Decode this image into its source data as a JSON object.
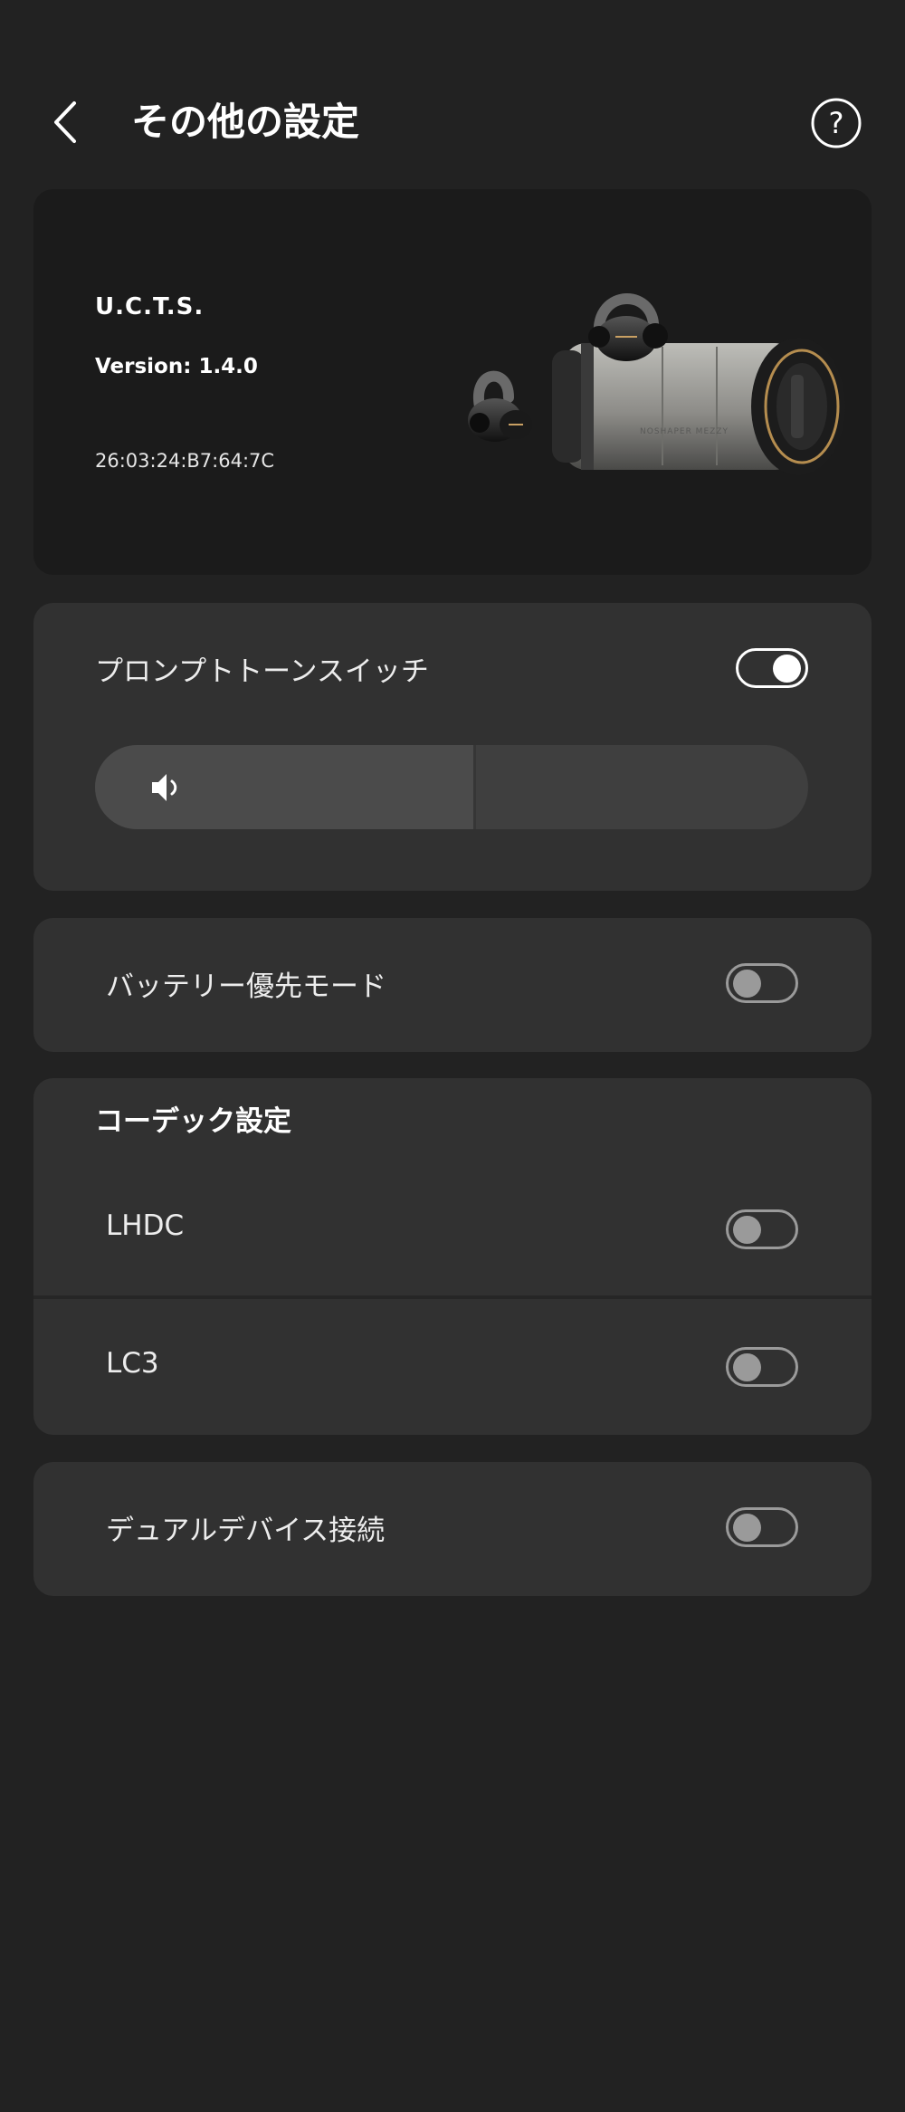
{
  "header": {
    "title": "その他の設定",
    "back_icon": "chevron-left-icon",
    "help_icon": "question-circle-icon"
  },
  "device": {
    "name": "U.C.T.S.",
    "version": "Version: 1.4.0",
    "mac": "26:03:24:B7:64:7C",
    "image_icon": "earbuds-with-charging-case-image"
  },
  "prompt_tone": {
    "label": "プロンプトトーンスイッチ",
    "enabled": true,
    "volume_fraction": 0.53,
    "volume_icon": "speaker-icon"
  },
  "battery_mode": {
    "label": "バッテリー優先モード",
    "enabled": false
  },
  "codec": {
    "title": "コーデック設定",
    "items": [
      {
        "label": "LHDC",
        "enabled": false
      },
      {
        "label": "LC3",
        "enabled": false
      }
    ]
  },
  "dual_device": {
    "label": "デュアルデバイス接続",
    "enabled": false
  },
  "colors": {
    "background": "#222222",
    "card": "#313131",
    "device_card": "#1b1b1b",
    "toggle_off": "#9a9a9a",
    "toggle_on": "#ffffff"
  }
}
